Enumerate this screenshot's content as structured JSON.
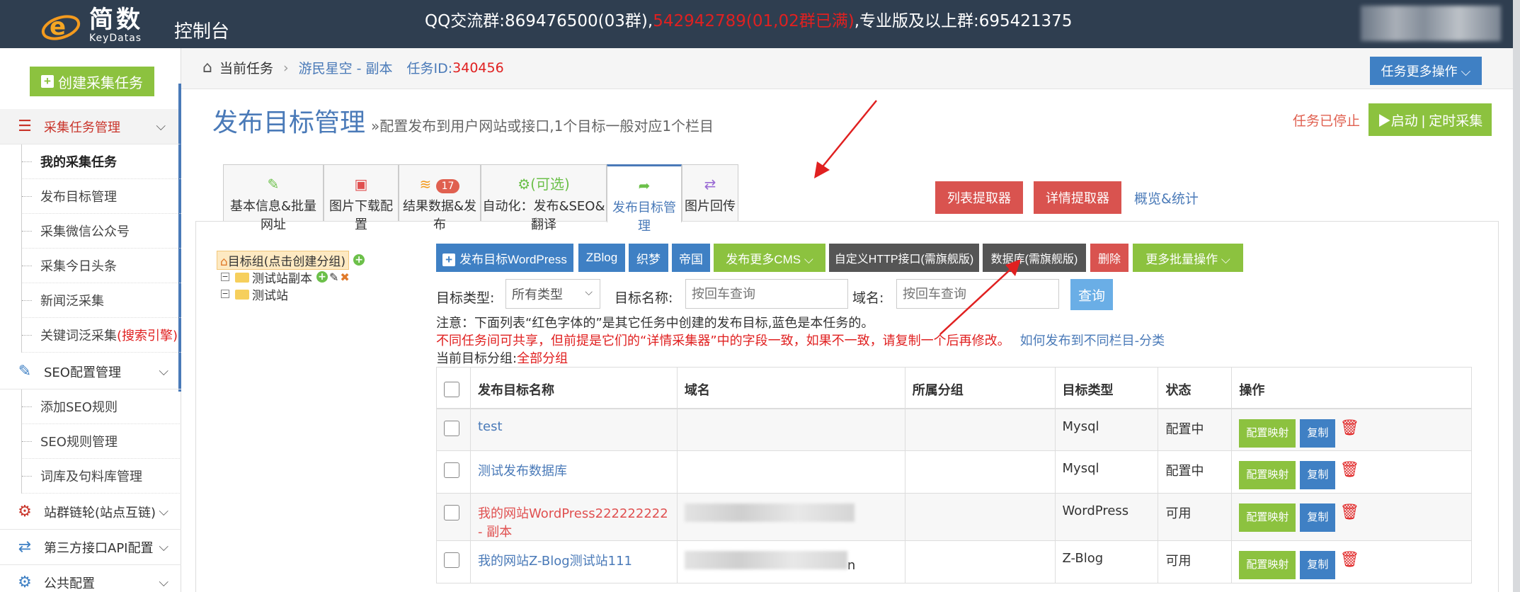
{
  "header": {
    "logo_cn": "简数",
    "logo_en": "KeyDatas",
    "console": "控制台",
    "announce_a": "QQ交流群:869476500(03群),",
    "announce_red": "542942789(01,02群已满)",
    "announce_b": ",专业版及以上群:695421375"
  },
  "colors": {
    "topbar": "#2f3e50",
    "green": "#8cc23f",
    "blue": "#3f80c4",
    "red_btn": "#d9534f",
    "dark_btn": "#555555",
    "accent_red": "#e02020",
    "link_blue": "#4a7ab8"
  },
  "sidebar": {
    "create_task": "创建采集任务",
    "group_collect": "采集任务管理",
    "collect_items": [
      "我的采集任务",
      "发布目标管理",
      "采集微信公众号",
      "采集今日头条",
      "新闻泛采集"
    ],
    "keyword_item": "关键词泛采集",
    "keyword_item_red": "(搜索引擎)",
    "group_seo": "SEO配置管理",
    "seo_items": [
      "添加SEO规则",
      "SEO规则管理",
      "词库及句料库管理"
    ],
    "group_sitelink": "站群链轮(站点互链)",
    "group_api": "第三方接口API配置",
    "group_common": "公共配置"
  },
  "breadcrumb": {
    "current": "当前任务",
    "task_name": "游民星空 - 副本",
    "task_id_label": "任务ID:",
    "task_id": "340456",
    "more_ops": "任务更多操作"
  },
  "page": {
    "title": "发布目标管理",
    "subtitle": "»配置发布到用户网站或接口,1个目标一般对应1个栏目",
    "status": "任务已停止",
    "start": "▶启动 | 定时采集"
  },
  "tabs": [
    {
      "label": "基本信息&批量网址",
      "icon": "edit-icon"
    },
    {
      "label": "图片下载配置",
      "icon": "image-icon"
    },
    {
      "label": "结果数据&发布",
      "icon": "database-icon",
      "badge": "17"
    },
    {
      "label": "自动化：发布&SEO&翻译",
      "icon": "gears-icon",
      "top": "(可选)"
    },
    {
      "label": "发布目标管理",
      "icon": "share-icon"
    },
    {
      "label": "图片回传",
      "icon": "exchange-icon"
    }
  ],
  "tab_actions": {
    "list_extractor": "列表提取器",
    "detail_extractor": "详情提取器",
    "overview": "概览&统计"
  },
  "tree": {
    "root": "目标组(点击创建分组)",
    "children": [
      "测试站副本",
      "测试站"
    ]
  },
  "toolbar": {
    "wordpress": "发布目标WordPress",
    "zblog": "ZBlog",
    "zhimeng": "织梦",
    "diguo": "帝国",
    "more_cms": "发布更多CMS",
    "http": "自定义HTTP接口(需旗舰版)",
    "database": "数据库(需旗舰版)",
    "delete": "删除",
    "batch": "更多批量操作"
  },
  "filters": {
    "type_label": "目标类型:",
    "type_value": "所有类型",
    "name_label": "目标名称:",
    "name_placeholder": "按回车查询",
    "domain_label": "域名:",
    "domain_placeholder": "按回车查询",
    "query": "查询"
  },
  "notes": {
    "line1": "注意：下面列表“红色字体的”是其它任务中创建的发布目标,蓝色是本任务的。",
    "line2_red": "不同任务间可共享，但前提是它们的“详情采集器”中的字段一致，如果不一致，请复制一个后再修改。",
    "line2_link": "如何发布到不同栏目-分类",
    "group_label": "当前目标分组:",
    "group_value": "全部分组"
  },
  "table": {
    "headers": [
      "发布目标名称",
      "域名",
      "所属分组",
      "目标类型",
      "状态",
      "操作"
    ],
    "rows": [
      {
        "name": "test",
        "type": "Mysql",
        "status": "配置中",
        "color": "blue",
        "domain_tail": ""
      },
      {
        "name": "测试发布数据库",
        "type": "Mysql",
        "status": "配置中",
        "color": "blue",
        "domain_tail": ""
      },
      {
        "name": "我的网站WordPress222222222 - 副本",
        "type": "WordPress",
        "status": "可用",
        "color": "red",
        "domain_tail": ""
      },
      {
        "name": "我的网站Z-Blog测试站111",
        "type": "Z-Blog",
        "status": "可用",
        "color": "blue",
        "domain_tail": "n"
      }
    ],
    "op_map": "配置映射",
    "op_copy": "复制"
  }
}
